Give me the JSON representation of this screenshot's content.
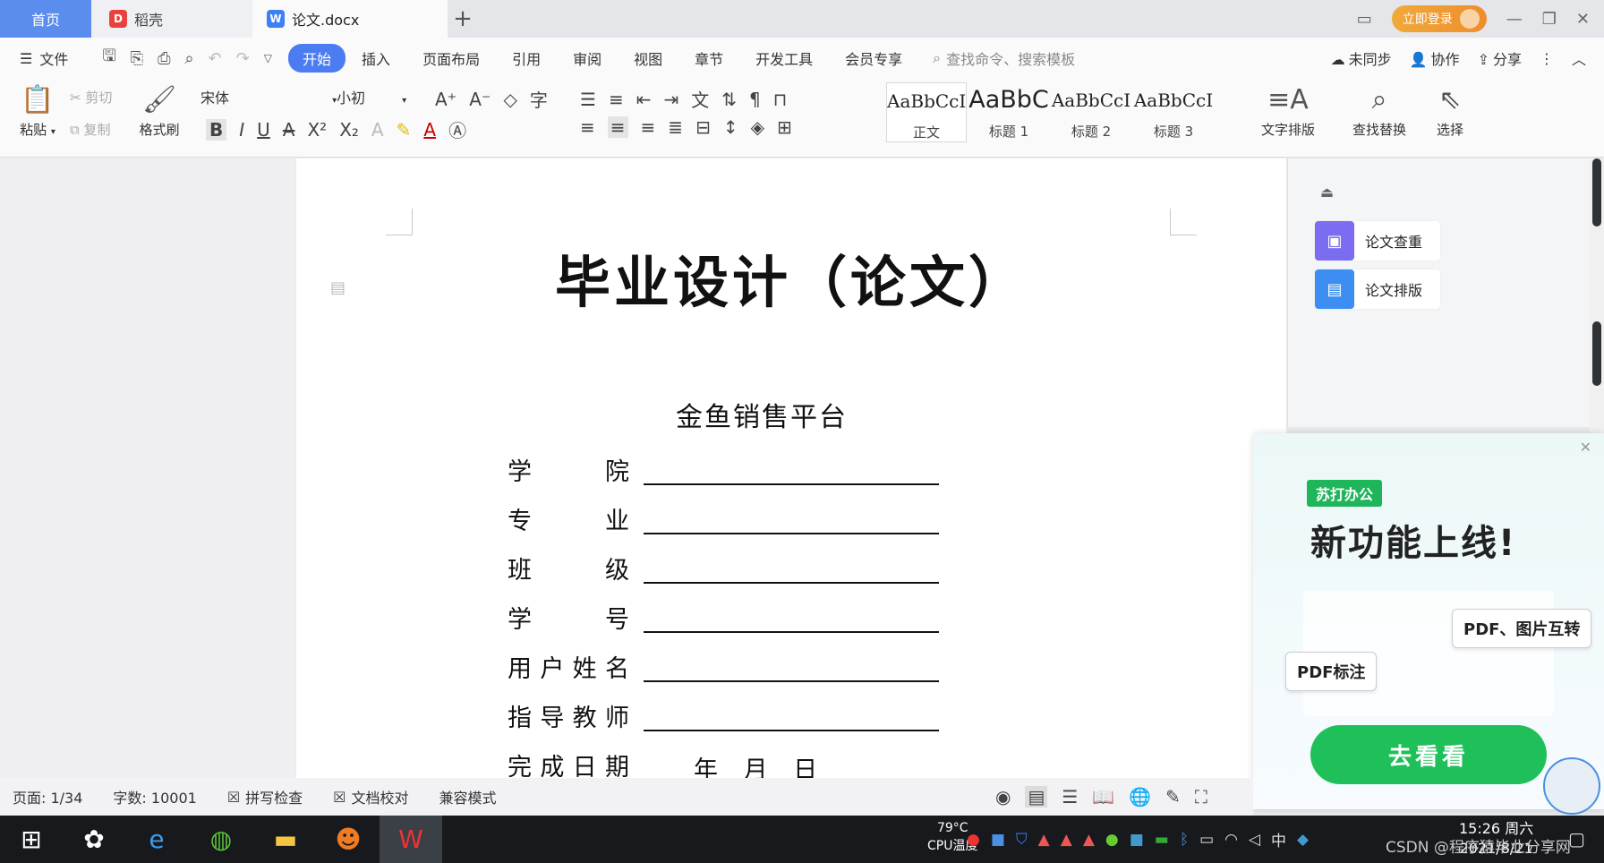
{
  "tabs": {
    "home": "首页",
    "daoke": "稻壳",
    "document": "论文.docx",
    "add": "+"
  },
  "window": {
    "login": "立即登录"
  },
  "menu": {
    "file": "文件",
    "tabs": [
      "开始",
      "插入",
      "页面布局",
      "引用",
      "审阅",
      "视图",
      "章节",
      "开发工具",
      "会员专享"
    ],
    "search_placeholder": "查找命令、搜索模板",
    "sync": "未同步",
    "collaborate": "协作",
    "share": "分享"
  },
  "ribbon": {
    "paste": "粘贴",
    "cut": "剪切",
    "copy": "复制",
    "format_painter": "格式刷",
    "font": "宋体",
    "size": "小初",
    "styles": [
      {
        "preview": "AaBbCcI",
        "name": "正文"
      },
      {
        "preview": "AaBbC",
        "name": "标题 1"
      },
      {
        "preview": "AaBbCcI",
        "name": "标题 2"
      },
      {
        "preview": "AaBbCcI",
        "name": "标题 3"
      }
    ],
    "text_layout": "文字排版",
    "find_replace": "查找替换",
    "select": "选择"
  },
  "document": {
    "title": "毕业设计（论文）",
    "subtitle": "金鱼销售平台",
    "fields": [
      {
        "label": "学院",
        "value": ""
      },
      {
        "label": "专业",
        "value": ""
      },
      {
        "label": "班级",
        "value": ""
      },
      {
        "label": "学号",
        "value": ""
      },
      {
        "label": "用户姓名",
        "value": ""
      },
      {
        "label": "指导教师",
        "value": ""
      },
      {
        "label": "完成日期",
        "value": "年 月 日"
      }
    ]
  },
  "task_pane": {
    "check": "论文查重",
    "format": "论文排版"
  },
  "ad": {
    "brand": "苏打办公",
    "headline": "新功能上线!",
    "tag1": "PDF、图片互转",
    "tag2": "PDF标注",
    "cta": "去看看"
  },
  "status": {
    "page": "页面: 1/34",
    "words": "字数: 10001",
    "spell": "拼写检查",
    "proof": "文档校对",
    "compat": "兼容模式"
  },
  "taskbar": {
    "cpu_temp": "79°C",
    "cpu_label": "CPU温度",
    "time": "15:26 周六",
    "date": "2021/8/21",
    "watermark": "CSDN @程序猿毕业分享网"
  }
}
